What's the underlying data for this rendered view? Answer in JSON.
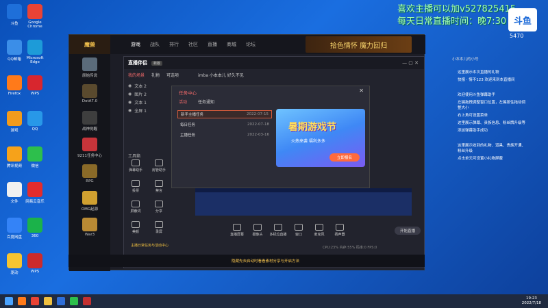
{
  "overlay": {
    "line1": "喜欢主播可以加v527825415~",
    "line2": "每天日常直播时间：晚7:30",
    "room_number": "5470",
    "logo_text": "斗鱼"
  },
  "desktop_icons": [
    {
      "label": "斗鱼",
      "color": "#1e6fd9"
    },
    {
      "label": "Google Chrome",
      "color": "#e94335"
    },
    {
      "label": "QQ邮箱",
      "color": "#3b8ee8"
    },
    {
      "label": "Microsoft Edge",
      "color": "#1d9bd8"
    },
    {
      "label": "Firefox",
      "color": "#ff7a1a"
    },
    {
      "label": "WPS",
      "color": "#d8262e"
    },
    {
      "label": "游戏",
      "color": "#f29b1c"
    },
    {
      "label": "QQ",
      "color": "#2898e8"
    },
    {
      "label": "腾讯视频",
      "color": "#f6a21a"
    },
    {
      "label": "微信",
      "color": "#2dbf4c"
    },
    {
      "label": "文件",
      "color": "#f0f0f0"
    },
    {
      "label": "网易云音乐",
      "color": "#e32c2c"
    },
    {
      "label": "百度网盘",
      "color": "#3483f7"
    },
    {
      "label": "360",
      "color": "#1bb24a"
    },
    {
      "label": "驱动",
      "color": "#f5c431"
    },
    {
      "label": "WPS",
      "color": "#cc2b2b"
    }
  ],
  "app": {
    "tabs": [
      "游戏",
      "战队",
      "排行",
      "社区",
      "直播",
      "商城",
      "论坛"
    ],
    "banner": "拾色情怀 魔力回归",
    "games": [
      {
        "label": "原始传说",
        "color": "#5b6b7a"
      },
      {
        "label": "DotA7.0",
        "color": "#5a4a2e"
      },
      {
        "label": "战神觉醒",
        "color": "#3e3e3e"
      },
      {
        "label": "9211任务中心",
        "color": "#c6343a"
      },
      {
        "label": "RPG",
        "color": "#8a6a28"
      },
      {
        "label": "OMG起源",
        "color": "#d0a030"
      },
      {
        "label": "War3",
        "color": "#b98a34"
      }
    ]
  },
  "inner": {
    "logo": "直播伴侣",
    "badge": "新版",
    "room_title": "imba 小本本儿 好久不见",
    "head_tabs": [
      "我的场景",
      "礼物",
      "可选项"
    ],
    "scenes": [
      "文本 2",
      "图片 2",
      "文本 1",
      "全屏 1"
    ],
    "tool_area_label": "工具箱",
    "tools": [
      "弹幕助手",
      "房管助手",
      "投票",
      "禁言",
      "屏蔽词",
      "分享",
      "美颜",
      "录屏"
    ],
    "bottom_tools": [
      "直播屏幕",
      "摄像头",
      "多机位直播",
      "窗口",
      "麦克风",
      "扬声器"
    ],
    "start_button": "开始直播",
    "status": "CPU:23%  内存:55%  码率:0  FPS:0",
    "ad_text": "隐藏先去启动时看看素材分享与开启方法",
    "sidebar_caption": "主播日常任务与活动中心"
  },
  "dialog": {
    "title": "任务中心",
    "tabs": [
      "活动",
      "任务通知"
    ],
    "tasks": [
      {
        "name": "新手主播任务",
        "date": "2022-07-15"
      },
      {
        "name": "每日任务",
        "date": "2022-07-18"
      },
      {
        "name": "主播任务",
        "date": "2022-03-16"
      }
    ],
    "promo_title": "暑期游戏节",
    "promo_sub": "火热来袭 福利多多",
    "promo_button": "立即报名"
  },
  "right_panel": {
    "user": "小本本儿的小号",
    "messages": [
      "这里展示本次直播的礼物",
      "快报 · 情不123 欢迎来到本直播间",
      "欢迎使用斗鱼弹幕助手",
      "左键拖拽调整窗口位置，左键按住拖动调整大小",
      "右上角可设置菜单",
      "这里展示弹幕、贵族信息、粉丝牌升级等",
      "添加弹幕助手成功",
      "这里展示收到的礼物、道具、贵族开通、粉丝升级",
      "点击单元可设置小礼物屏蔽"
    ]
  },
  "taskbar": {
    "time": "19:23",
    "date": "2022/7/18"
  }
}
